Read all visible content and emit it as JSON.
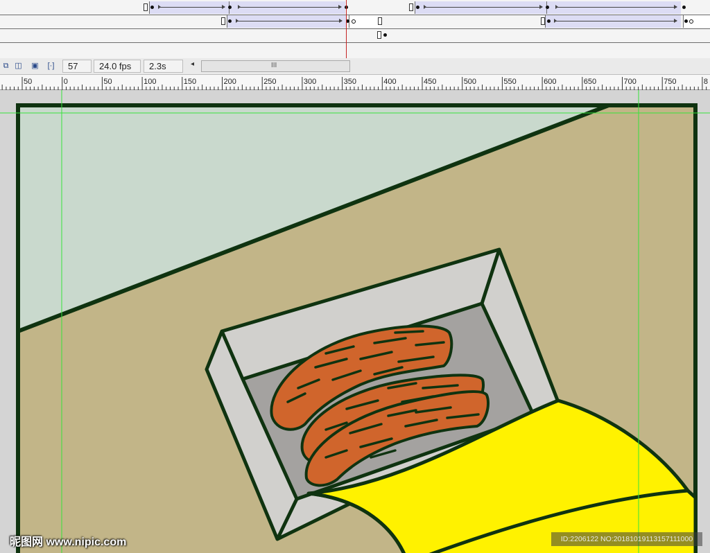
{
  "statusbar": {
    "frame": "57",
    "fps": "24.0 fps",
    "time": "2.3s",
    "scroll_grip": "III",
    "scroll_left_arrow": "◂"
  },
  "ruler": {
    "labels": [
      "50",
      "0",
      "50",
      "100",
      "150",
      "200",
      "250",
      "300",
      "350",
      "400",
      "450",
      "500",
      "550",
      "600",
      "650",
      "700",
      "750",
      "8"
    ]
  },
  "watermark": {
    "left": "昵图网 www.nipic.com",
    "right": "ID:2206122 NO:20181019113157111000"
  },
  "colors": {
    "sky": "#c9d9cd",
    "wall": "#c2b588",
    "outline": "#0f3310",
    "box_light": "#d1d0cd",
    "box_dark": "#a4a2a0",
    "meat": "#d0652c",
    "cloth": "#fff200",
    "guide": "#36e23a",
    "playhead": "#c42222"
  },
  "icons": {
    "onion_skin": "onion-skin-icon",
    "onion_outline": "onion-skin-outline-icon",
    "edit_multiple": "edit-multiple-frames-icon",
    "onion_markers": "modify-onion-markers-icon"
  }
}
